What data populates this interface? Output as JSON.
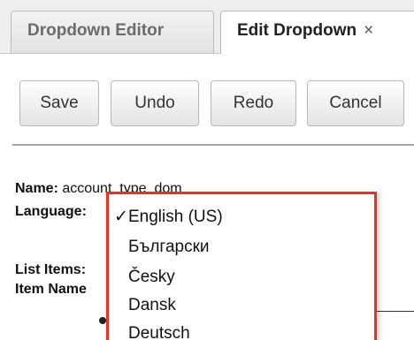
{
  "tabs": [
    {
      "label": "Dropdown Editor",
      "active": false
    },
    {
      "label": "Edit Dropdown",
      "active": true,
      "close_glyph": "×"
    }
  ],
  "toolbar": {
    "save_label": "Save",
    "undo_label": "Undo",
    "redo_label": "Redo",
    "cancel_label": "Cancel"
  },
  "form": {
    "name_label": "Name:",
    "name_value": "account_type_dom",
    "language_label": "Language:",
    "list_items_label": "List Items:",
    "item_name_label": "Item Name"
  },
  "language_dropdown": {
    "selected": "English (US)",
    "check_glyph": "✓",
    "options": [
      "English (US)",
      "Български",
      "Česky",
      "Dansk",
      "Deutsch"
    ]
  },
  "colors": {
    "highlight_border": "#e8321e",
    "tab_bar_bg": "#eeeeee",
    "button_border": "#b7b7b7"
  }
}
